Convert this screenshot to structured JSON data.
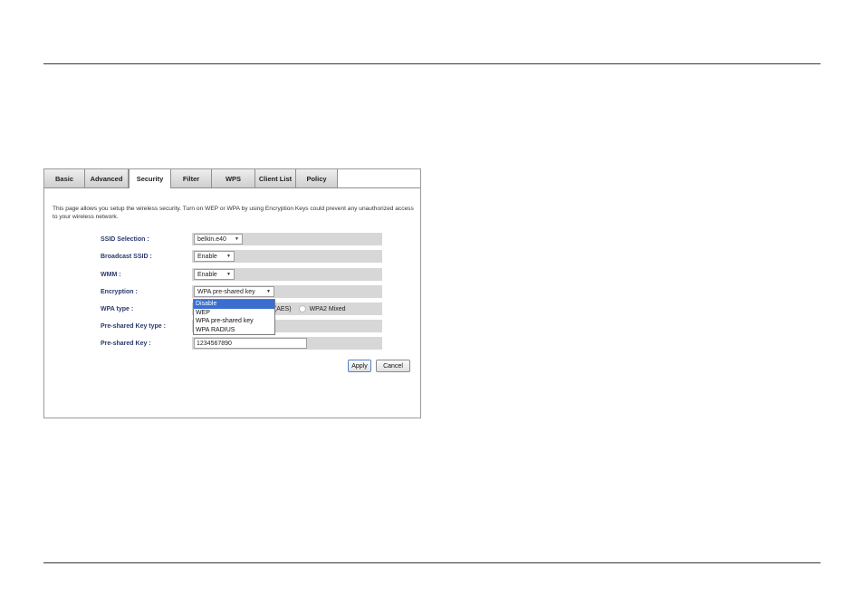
{
  "tabs": [
    "Basic",
    "Advanced",
    "Security",
    "Filter",
    "WPS",
    "Client List",
    "Policy"
  ],
  "active_tab": "Security",
  "description": "This page allows you setup the wireless security. Turn on WEP or WPA by using Encryption Keys could prevent any unauthorized access to your wireless network.",
  "fields": {
    "ssid_selection": {
      "label": "SSID Selection :",
      "value": "belkin.e40"
    },
    "broadcast_ssid": {
      "label": "Broadcast SSID :",
      "value": "Enable"
    },
    "wmm": {
      "label": "WMM :",
      "value": "Enable"
    },
    "encryption": {
      "label": "Encryption :",
      "value": "WPA pre-shared key"
    },
    "wpa_type": {
      "label": "WPA type :",
      "options_visible": [
        "2(AES)",
        "WPA2 Mixed"
      ]
    },
    "psk_type": {
      "label": "Pre-shared Key type :"
    },
    "psk": {
      "label": "Pre-shared Key :",
      "value": "1234567890"
    }
  },
  "encryption_dropdown": {
    "options": [
      "Disable",
      "WEP",
      "WPA pre-shared key",
      "WPA RADIUS"
    ],
    "highlighted": "Disable"
  },
  "buttons": {
    "apply": "Apply",
    "cancel": "Cancel"
  },
  "colors": {
    "label_text": "#2b3a6e",
    "row_bg": "#d7d7d7",
    "highlight": "#3a6fd0"
  }
}
